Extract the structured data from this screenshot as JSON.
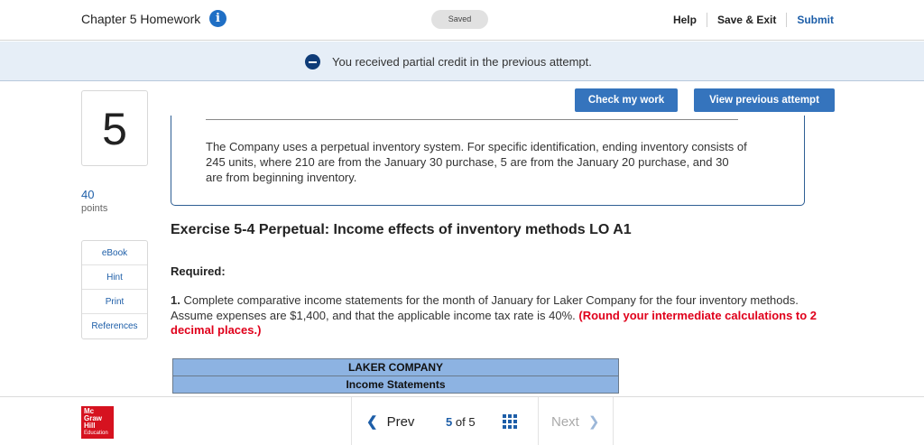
{
  "header": {
    "title": "Chapter 5 Homework",
    "status": "Saved",
    "help": "Help",
    "save_exit": "Save & Exit",
    "submit": "Submit"
  },
  "banner": {
    "message": "You received partial credit in the previous attempt."
  },
  "question": {
    "number": "5",
    "points": "40",
    "points_label": "points"
  },
  "resources": [
    "eBook",
    "Hint",
    "Print",
    "References"
  ],
  "actions": {
    "check_work": "Check my work",
    "view_previous": "View previous attempt"
  },
  "info_text": "The Company uses a perpetual inventory system. For specific identification, ending inventory consists of 245 units, where 210 are from the January 30 purchase, 5 are from the January 20 purchase, and 30 are from beginning inventory.",
  "exercise": {
    "title": "Exercise 5-4 Perpetual: Income effects of inventory methods LO A1",
    "required": "Required:",
    "item_number": "1.",
    "instruction": " Complete comparative income statements for the month of January for Laker Company for the four inventory methods. Assume expenses are $1,400, and that the applicable income tax rate is 40%. ",
    "note": "(Round your intermediate calculations to 2 decimal places.)"
  },
  "table": {
    "company": "LAKER COMPANY",
    "subtitle": "Income Statements"
  },
  "footer": {
    "logo_line1": "Mc",
    "logo_line2": "Graw",
    "logo_line3": "Hill",
    "logo_line4": "Education",
    "prev": "Prev",
    "current_page": "5",
    "of": "of",
    "total_pages": "5",
    "next": "Next"
  },
  "colors": {
    "accent": "#3574bd",
    "banner_bg": "#e6eef7",
    "table_header": "#8db3e2",
    "warning_red": "#e0001b",
    "logo_red": "#d6121f"
  },
  "icons": [
    "info-icon",
    "minus-circle-icon",
    "chevron-left-icon",
    "grid-icon",
    "chevron-right-icon"
  ]
}
